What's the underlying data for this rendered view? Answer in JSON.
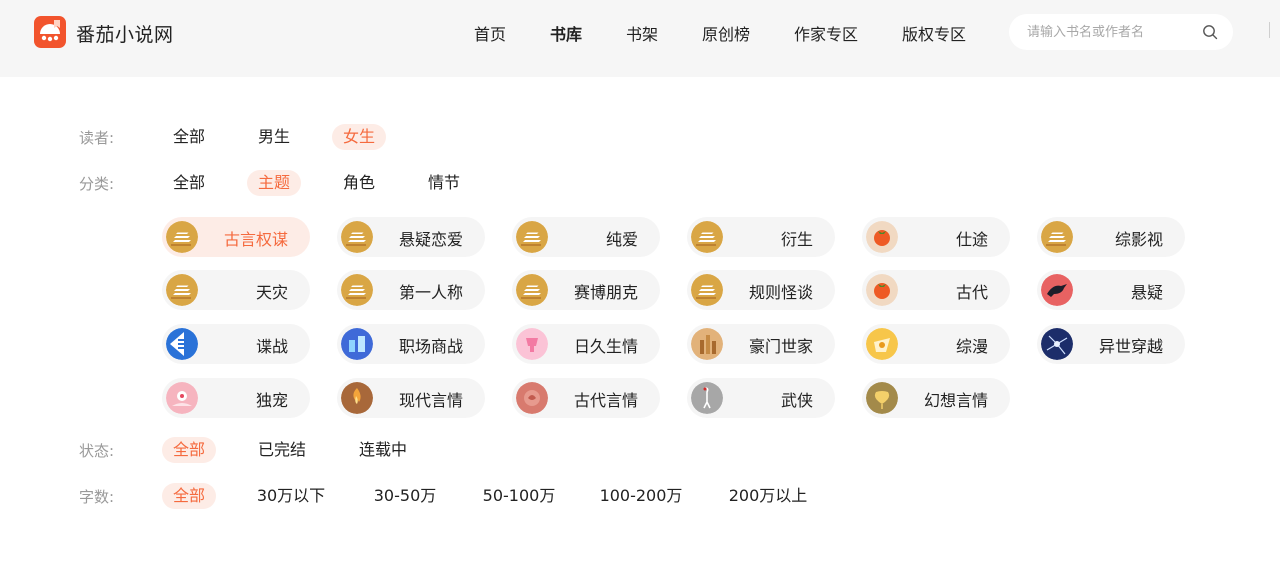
{
  "header": {
    "brand": "番茄小说网",
    "nav": [
      "首页",
      "书库",
      "书架",
      "原创榜",
      "作家专区",
      "版权专区"
    ],
    "active_nav": 1,
    "search_placeholder": "请输入书名或作者名"
  },
  "filters": {
    "reader": {
      "label": "读者:",
      "options": [
        "全部",
        "男生",
        "女生"
      ],
      "active": 2
    },
    "category": {
      "label": "分类:",
      "options": [
        "全部",
        "主题",
        "角色",
        "情节"
      ],
      "active": 1
    },
    "status": {
      "label": "状态:",
      "options": [
        "全部",
        "已完结",
        "连载中"
      ],
      "active": 0
    },
    "words": {
      "label": "字数:",
      "options": [
        "全部",
        "30万以下",
        "30-50万",
        "50-100万",
        "100-200万",
        "200万以上"
      ],
      "active": 0
    }
  },
  "themes": [
    {
      "label": "古言权谋",
      "icon": "book-stack-icon",
      "active": true
    },
    {
      "label": "悬疑恋爱",
      "icon": "book-stack-icon"
    },
    {
      "label": "纯爱",
      "icon": "book-stack-icon"
    },
    {
      "label": "衍生",
      "icon": "book-stack-icon"
    },
    {
      "label": "仕途",
      "icon": "tomato-icon"
    },
    {
      "label": "综影视",
      "icon": "book-stack-icon"
    },
    {
      "label": "天灾",
      "icon": "book-stack-icon"
    },
    {
      "label": "第一人称",
      "icon": "book-stack-icon"
    },
    {
      "label": "赛博朋克",
      "icon": "book-stack-icon"
    },
    {
      "label": "规则怪谈",
      "icon": "book-stack-icon"
    },
    {
      "label": "古代",
      "icon": "tomato-icon"
    },
    {
      "label": "悬疑",
      "icon": "crow-icon"
    },
    {
      "label": "谍战",
      "icon": "spy-icon"
    },
    {
      "label": "职场商战",
      "icon": "business-icon"
    },
    {
      "label": "日久生情",
      "icon": "heart-cup-icon"
    },
    {
      "label": "豪门世家",
      "icon": "castle-icon"
    },
    {
      "label": "综漫",
      "icon": "anime-icon"
    },
    {
      "label": "异世穿越",
      "icon": "portal-icon"
    },
    {
      "label": "独宠",
      "icon": "flower-hand-icon"
    },
    {
      "label": "现代言情",
      "icon": "flame-icon"
    },
    {
      "label": "古代言情",
      "icon": "rose-icon"
    },
    {
      "label": "武侠",
      "icon": "crane-icon"
    },
    {
      "label": "幻想言情",
      "icon": "ginkgo-icon"
    }
  ],
  "colors": {
    "accent": "#f56a3e",
    "active_bg": "#fdece6",
    "chip_bg": "#f5f5f5"
  }
}
